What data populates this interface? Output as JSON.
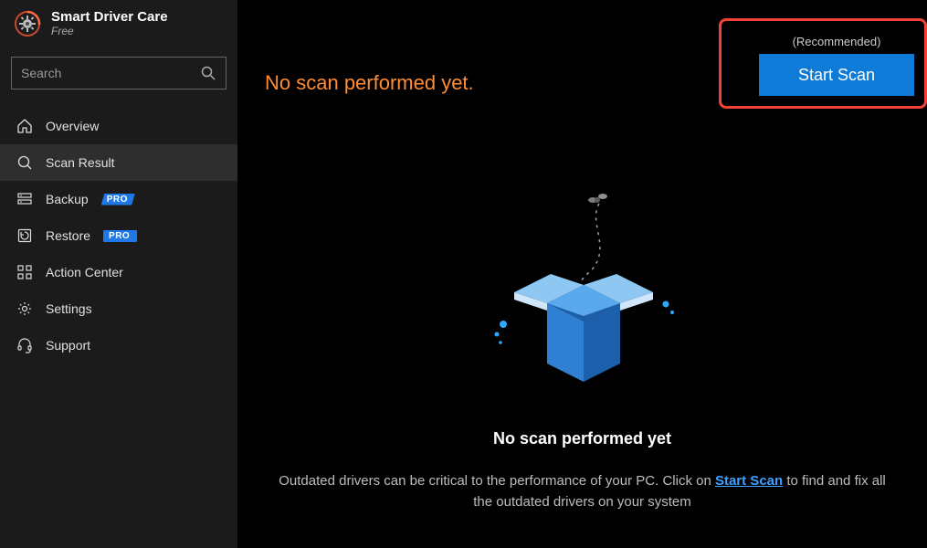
{
  "colors": {
    "accent": "#0e7bd8",
    "highlight_border": "#f44336",
    "status_text": "#ff8c33",
    "link": "#3ca1ff",
    "sidebar_bg": "#1b1b1b",
    "sidebar_active_bg": "#2e2e2e"
  },
  "brand": {
    "title": "Smart Driver Care",
    "edition": "Free"
  },
  "search": {
    "placeholder": "Search"
  },
  "sidebar": {
    "items": [
      {
        "label": "Overview",
        "icon": "home-icon",
        "active": false,
        "badge": null
      },
      {
        "label": "Scan Result",
        "icon": "scan-icon",
        "active": true,
        "badge": null
      },
      {
        "label": "Backup",
        "icon": "backup-icon",
        "active": false,
        "badge": "PRO"
      },
      {
        "label": "Restore",
        "icon": "restore-icon",
        "active": false,
        "badge": "PRO"
      },
      {
        "label": "Action Center",
        "icon": "grid-icon",
        "active": false,
        "badge": null
      },
      {
        "label": "Settings",
        "icon": "gear-icon",
        "active": false,
        "badge": null
      },
      {
        "label": "Support",
        "icon": "headset-icon",
        "active": false,
        "badge": null
      }
    ]
  },
  "main": {
    "status_message": "No scan performed yet.",
    "recommended_label": "(Recommended)",
    "start_scan_label": "Start Scan",
    "empty_title": "No scan performed yet",
    "empty_desc_before": "Outdated drivers can be critical to the performance of your PC. Click on ",
    "empty_desc_link": "Start Scan",
    "empty_desc_after": " to find and fix all the outdated drivers on your system"
  }
}
